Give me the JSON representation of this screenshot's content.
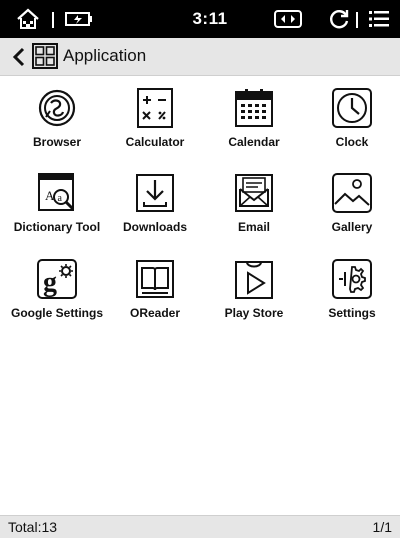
{
  "status_bar": {
    "time": "3:11",
    "icons": [
      "home-icon",
      "battery-icon",
      "refresh-mode-icon",
      "sync-icon",
      "menu-icon"
    ]
  },
  "header": {
    "title": "Application",
    "back_icon": "chevron-left-icon",
    "view_icon": "grid-view-icon"
  },
  "apps": [
    {
      "label": "Browser",
      "icon": "browser-icon"
    },
    {
      "label": "Calculator",
      "icon": "calculator-icon"
    },
    {
      "label": "Calendar",
      "icon": "calendar-icon"
    },
    {
      "label": "Clock",
      "icon": "clock-icon"
    },
    {
      "label": "Dictionary Tool",
      "icon": "dictionary-icon"
    },
    {
      "label": "Downloads",
      "icon": "downloads-icon"
    },
    {
      "label": "Email",
      "icon": "email-icon"
    },
    {
      "label": "Gallery",
      "icon": "gallery-icon"
    },
    {
      "label": "Google Settings",
      "icon": "google-settings-icon"
    },
    {
      "label": "OReader",
      "icon": "oreader-icon"
    },
    {
      "label": "Play Store",
      "icon": "play-store-icon"
    },
    {
      "label": "Settings",
      "icon": "settings-icon"
    }
  ],
  "footer": {
    "total": "Total:13",
    "page": "1/1"
  }
}
